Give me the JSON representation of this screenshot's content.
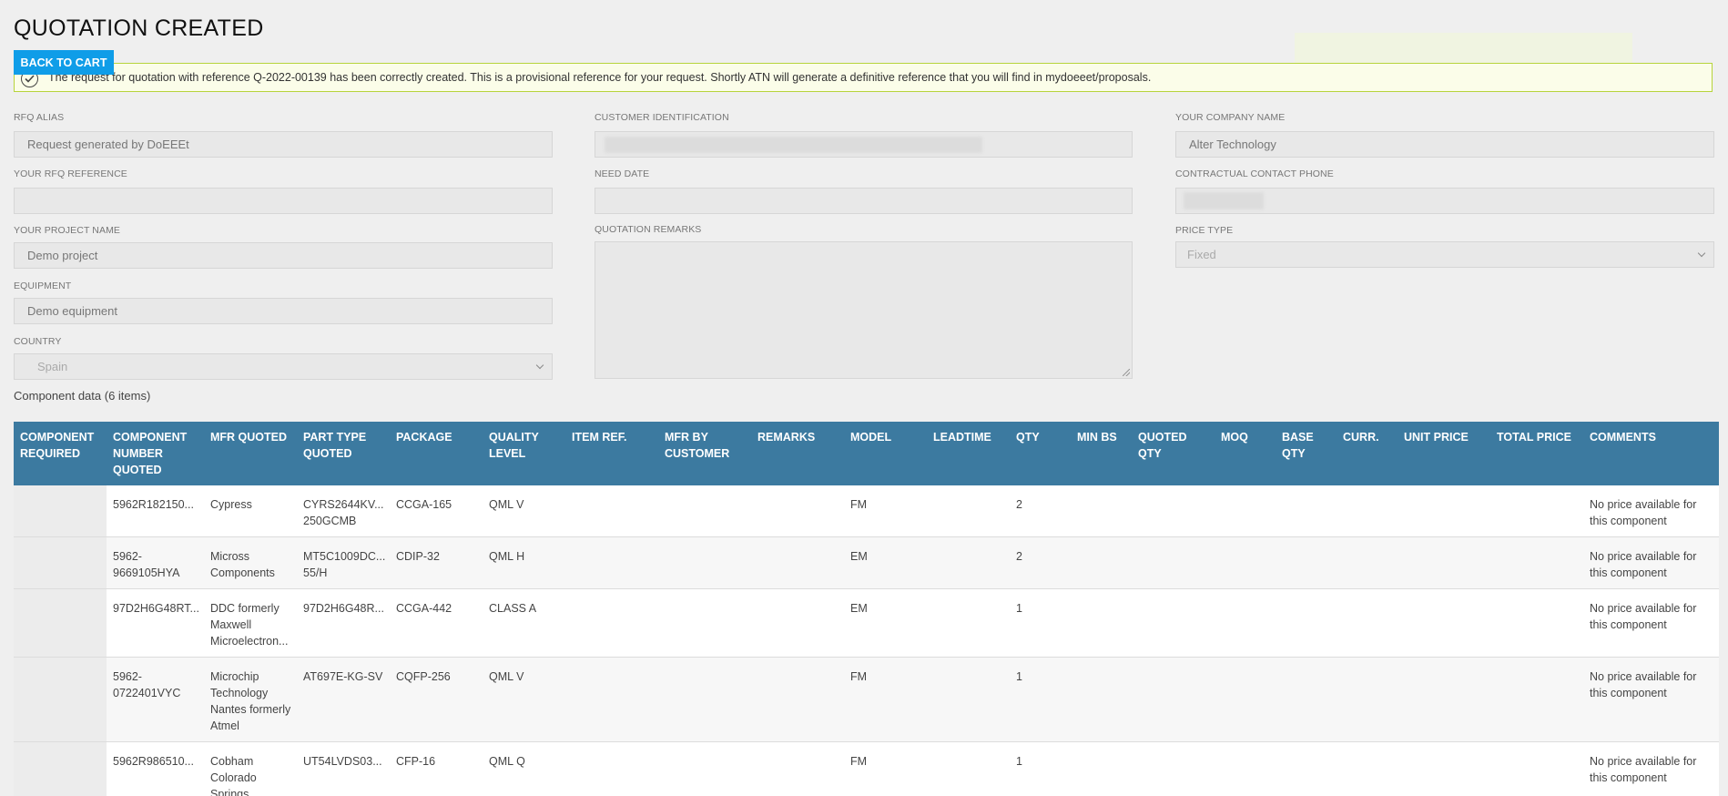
{
  "page": {
    "title": "QUOTATION CREATED",
    "back_button": "BACK TO CART"
  },
  "alert": {
    "message": "The request for quotation with reference Q-2022-00139 has been correctly created. This is a provisional reference for your request. Shortly ATN will generate a definitive reference that you will find in mydoeeet/proposals.",
    "icon": "check-circle-icon"
  },
  "form": {
    "rfq_alias": {
      "label": "RFQ ALIAS",
      "value": "Request generated by DoEEEt"
    },
    "your_rfq_reference": {
      "label": "YOUR RFQ REFERENCE",
      "value": ""
    },
    "your_project_name": {
      "label": "YOUR PROJECT NAME",
      "value": "Demo project"
    },
    "equipment": {
      "label": "EQUIPMENT",
      "value": "Demo equipment"
    },
    "country": {
      "label": "COUNTRY",
      "value": "Spain"
    },
    "customer_identification": {
      "label": "CUSTOMER IDENTIFICATION",
      "value": ""
    },
    "need_date": {
      "label": "NEED DATE",
      "value": ""
    },
    "quotation_remarks": {
      "label": "QUOTATION REMARKS",
      "value": ""
    },
    "your_company_name": {
      "label": "YOUR COMPANY NAME",
      "value": "Alter Technology"
    },
    "contractual_contact_phone": {
      "label": "CONTRACTUAL CONTACT PHONE",
      "value": ""
    },
    "price_type": {
      "label": "PRICE TYPE",
      "value": "Fixed"
    }
  },
  "components": {
    "title": "Component data (6 items)",
    "columns": [
      "COMPONENT REQUIRED",
      "COMPONENT NUMBER QUOTED",
      "MFR QUOTED",
      "PART TYPE QUOTED",
      "PACKAGE",
      "QUALITY LEVEL",
      "ITEM REF.",
      "MFR BY CUSTOMER",
      "REMARKS",
      "MODEL",
      "LEADTIME",
      "QTY",
      "MIN BS",
      "QUOTED QTY",
      "MOQ",
      "BASE QTY",
      "CURR.",
      "UNIT PRICE",
      "TOTAL PRICE",
      "COMMENTS"
    ],
    "rows": [
      {
        "required": "",
        "number": "5962R182150...",
        "mfr": "Cypress",
        "part_type": "CYRS2644KV... 250GCMB",
        "package": "CCGA-165",
        "quality": "QML V",
        "item_ref": "",
        "mfr_customer": "",
        "remarks": "",
        "model": "FM",
        "leadtime": "",
        "qty": "2",
        "min_bs": "",
        "quoted_qty": "",
        "moq": "",
        "base_qty": "",
        "curr": "",
        "unit_price": "",
        "total_price": "",
        "comments": "No price available for this component"
      },
      {
        "required": "",
        "number": "5962-9669105HYA",
        "mfr": "Micross Components",
        "part_type": "MT5C1009DC... 55/H",
        "package": "CDIP-32",
        "quality": "QML H",
        "item_ref": "",
        "mfr_customer": "",
        "remarks": "",
        "model": "EM",
        "leadtime": "",
        "qty": "2",
        "min_bs": "",
        "quoted_qty": "",
        "moq": "",
        "base_qty": "",
        "curr": "",
        "unit_price": "",
        "total_price": "",
        "comments": "No price available for this component"
      },
      {
        "required": "",
        "number": "97D2H6G48RT...",
        "mfr": "DDC formerly Maxwell Microelectron...",
        "part_type": "97D2H6G48R...",
        "package": "CCGA-442",
        "quality": "CLASS A",
        "item_ref": "",
        "mfr_customer": "",
        "remarks": "",
        "model": "EM",
        "leadtime": "",
        "qty": "1",
        "min_bs": "",
        "quoted_qty": "",
        "moq": "",
        "base_qty": "",
        "curr": "",
        "unit_price": "",
        "total_price": "",
        "comments": "No price available for this component"
      },
      {
        "required": "",
        "number": "5962-0722401VYC",
        "mfr": "Microchip Technology Nantes formerly Atmel",
        "part_type": "AT697E-KG-SV",
        "package": "CQFP-256",
        "quality": "QML V",
        "item_ref": "",
        "mfr_customer": "",
        "remarks": "",
        "model": "FM",
        "leadtime": "",
        "qty": "1",
        "min_bs": "",
        "quoted_qty": "",
        "moq": "",
        "base_qty": "",
        "curr": "",
        "unit_price": "",
        "total_price": "",
        "comments": "No price available for this component"
      },
      {
        "required": "",
        "number": "5962R986510...",
        "mfr": "Cobham Colorado Springs",
        "part_type": "UT54LVDS03...",
        "package": "CFP-16",
        "quality": "QML Q",
        "item_ref": "",
        "mfr_customer": "",
        "remarks": "",
        "model": "FM",
        "leadtime": "",
        "qty": "1",
        "min_bs": "",
        "quoted_qty": "",
        "moq": "",
        "base_qty": "",
        "curr": "",
        "unit_price": "",
        "total_price": "",
        "comments": "No price available for this component"
      }
    ]
  },
  "colors": {
    "header_bg": "#3c7aa0",
    "button_bg": "#0f9de8",
    "alert_border": "#b7d43c",
    "alert_bg": "#fbfde9"
  }
}
